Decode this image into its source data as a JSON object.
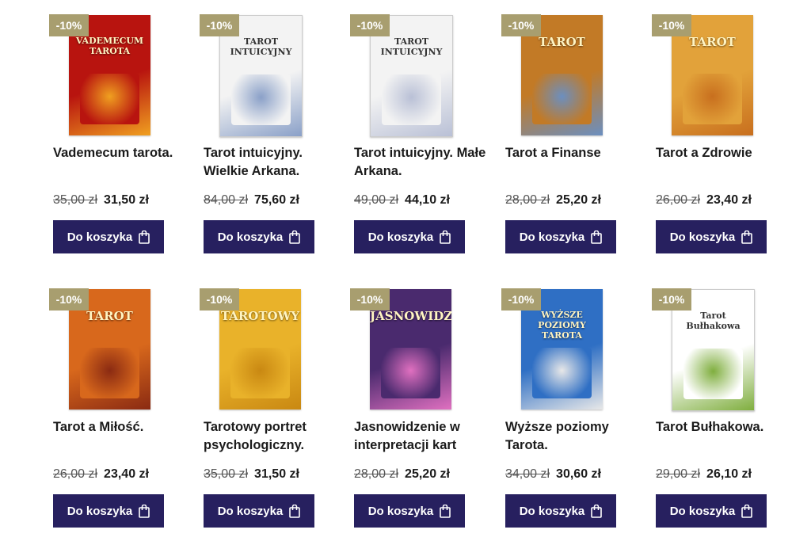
{
  "products": [
    {
      "badge": "-10%",
      "title": "Vademecum tarota.",
      "old_price": "35,00 zł",
      "new_price": "31,50 zł",
      "button": "Do koszyka",
      "cover_text": "VADEMECUM TAROTA",
      "cover_color": "#b8140f",
      "cover_accent": "#f0a020"
    },
    {
      "badge": "-10%",
      "title": "Tarot intuicyjny. Wielkie Arkana.",
      "old_price": "84,00 zł",
      "new_price": "75,60 zł",
      "button": "Do koszyka",
      "cover_text": "TAROT INTUICYJNY",
      "cover_color": "#f3f3f3",
      "cover_accent": "#8aa0c8"
    },
    {
      "badge": "-10%",
      "title": "Tarot intuicyjny. Małe Arkana.",
      "old_price": "49,00 zł",
      "new_price": "44,10 zł",
      "button": "Do koszyka",
      "cover_text": "TAROT INTUICYJNY",
      "cover_color": "#f3f3f3",
      "cover_accent": "#b9c0d6"
    },
    {
      "badge": "-10%",
      "title": "Tarot a Finanse",
      "old_price": "28,00 zł",
      "new_price": "25,20 zł",
      "button": "Do koszyka",
      "cover_text": "TAROT",
      "cover_color": "#c27a26",
      "cover_accent": "#6b8fc0"
    },
    {
      "badge": "-10%",
      "title": "Tarot a Zdrowie",
      "old_price": "26,00 zł",
      "new_price": "23,40 zł",
      "button": "Do koszyka",
      "cover_text": "TAROT",
      "cover_color": "#e2a23a",
      "cover_accent": "#c86f1e"
    },
    {
      "badge": "-10%",
      "title": "Tarot a Miłość.",
      "old_price": "26,00 zł",
      "new_price": "23,40 zł",
      "button": "Do koszyka",
      "cover_text": "TAROT",
      "cover_color": "#d8681c",
      "cover_accent": "#8a2a12"
    },
    {
      "badge": "-10%",
      "title": "Tarotowy portret psychologiczny.",
      "old_price": "35,00 zł",
      "new_price": "31,50 zł",
      "button": "Do koszyka",
      "cover_text": "TAROTOWY",
      "cover_color": "#e9b22a",
      "cover_accent": "#c98812"
    },
    {
      "badge": "-10%",
      "title": "Jasnowidzenie w interpretacji kart",
      "old_price": "28,00 zł",
      "new_price": "25,20 zł",
      "button": "Do koszyka",
      "cover_text": "JASNOWIDZENIE",
      "cover_color": "#4a2a6e",
      "cover_accent": "#e070c0"
    },
    {
      "badge": "-10%",
      "title": "Wyższe poziomy Tarota.",
      "old_price": "34,00 zł",
      "new_price": "30,60 zł",
      "button": "Do koszyka",
      "cover_text": "WYŻSZE POZIOMY TAROTA",
      "cover_color": "#2f6fc4",
      "cover_accent": "#e8e8e8"
    },
    {
      "badge": "-10%",
      "title": "Tarot Bułhakowa.",
      "old_price": "29,00 zł",
      "new_price": "26,10 zł",
      "button": "Do koszyka",
      "cover_text": "Tarot Bułhakowa",
      "cover_color": "#ffffff",
      "cover_accent": "#7fae3e"
    }
  ]
}
